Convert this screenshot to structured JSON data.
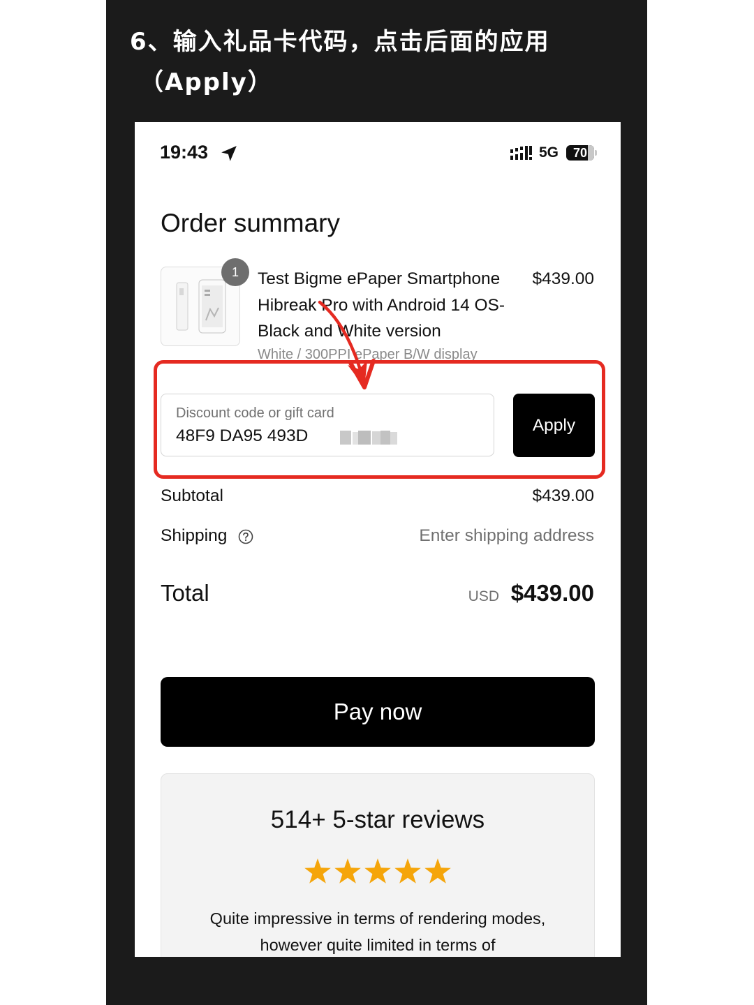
{
  "instruction": {
    "line1": "6、输入礼品卡代码，点击后面的应用",
    "line2": "（Apply）"
  },
  "status_bar": {
    "time": "19:43",
    "network": "5G",
    "battery": "70"
  },
  "page": {
    "title": "Order summary"
  },
  "product": {
    "quantity": "1",
    "name": "Test Bigme ePaper Smartphone Hibreak Pro with Android 14 OS- Black and White version",
    "price": "$439.00",
    "variant": "White / 300PPI ePaper B/W display"
  },
  "discount": {
    "placeholder": "Discount code or gift card",
    "value": "48F9 DA95 493D",
    "apply_label": "Apply"
  },
  "summary": {
    "subtotal_label": "Subtotal",
    "subtotal_value": "$439.00",
    "shipping_label": "Shipping",
    "shipping_value": "Enter shipping address",
    "total_label": "Total",
    "currency": "USD",
    "total_value": "$439.00"
  },
  "pay_button": "Pay now",
  "reviews": {
    "title": "514+ 5-star reviews",
    "rating": 5,
    "star_color": "#f5a50a",
    "text": "Quite impressive in terms of rendering modes, however quite limited in terms of"
  },
  "annotation_color": "#e52a21"
}
